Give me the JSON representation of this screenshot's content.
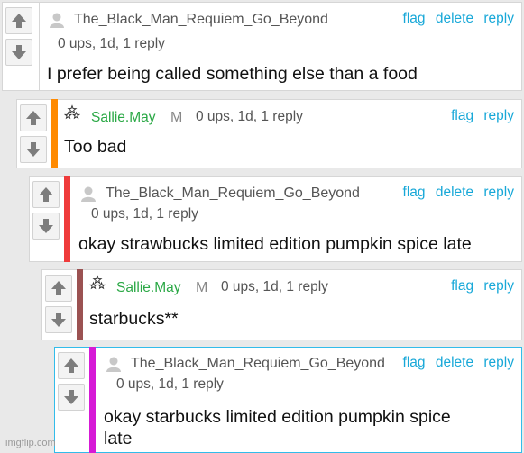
{
  "colors": {
    "link": "#18a8d8",
    "username_green": "#2aa845",
    "bar_orange": "#ff8a00",
    "bar_red": "#ef3b3b",
    "bar_brown": "#9b5252",
    "bar_magenta": "#d61ad6",
    "selected_border": "#32bcea"
  },
  "icons": {
    "upvote": "arrow-up-icon",
    "downvote": "arrow-down-icon",
    "user": "user-avatar-icon",
    "badge": "stars-badge-icon"
  },
  "comments": [
    {
      "username": "The_Black_Man_Requiem_Go_Beyond",
      "meta": "0 ups, 1d, 1 reply",
      "actions": {
        "flag": "flag",
        "delete": "delete",
        "reply": "reply"
      },
      "text": "I prefer being called something else than a food"
    },
    {
      "username": "Sallie.May",
      "mod_badge": "M",
      "meta": "0 ups, 1d, 1 reply",
      "actions": {
        "flag": "flag",
        "reply": "reply"
      },
      "text": "Too bad"
    },
    {
      "username": "The_Black_Man_Requiem_Go_Beyond",
      "meta": "0 ups, 1d, 1 reply",
      "actions": {
        "flag": "flag",
        "delete": "delete",
        "reply": "reply"
      },
      "text": "okay strawbucks limited edition pumpkin spice late"
    },
    {
      "username": "Sallie.May",
      "mod_badge": "M",
      "meta": "0 ups, 1d, 1 reply",
      "actions": {
        "flag": "flag",
        "reply": "reply"
      },
      "text": "starbucks**"
    },
    {
      "username": "The_Black_Man_Requiem_Go_Beyond",
      "meta": "0 ups, 1d, 1 reply",
      "actions": {
        "flag": "flag",
        "delete": "delete",
        "reply": "reply"
      },
      "text_line1": "okay starbucks limited edition pumpkin spice",
      "text_line2": "late"
    }
  ],
  "watermark": "imgflip.com"
}
